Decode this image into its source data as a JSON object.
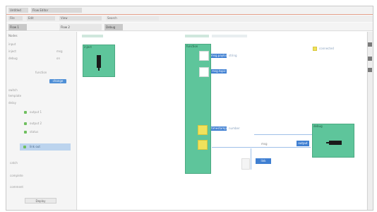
{
  "window": {
    "tabs": [
      "Untitled",
      "Flow Editor"
    ]
  },
  "toolbar": {
    "items": [
      "File",
      "Edit",
      "View",
      "Search"
    ]
  },
  "tabbar": {
    "tabs": [
      "Flow 1",
      "Flow 2",
      "Debug"
    ]
  },
  "sidebar": {
    "header": "Nodes",
    "rows": [
      {
        "label": "input",
        "value": ""
      },
      {
        "label": "inject",
        "value": "msg"
      },
      {
        "label": "debug",
        "value": "on"
      },
      {
        "label": "function",
        "value": ""
      },
      {
        "label": "change",
        "value": ""
      },
      {
        "label": "switch",
        "value": ""
      },
      {
        "label": "template",
        "value": ""
      },
      {
        "label": "delay",
        "value": ""
      }
    ],
    "group_items": [
      {
        "label": "output 1"
      },
      {
        "label": "output 2"
      },
      {
        "label": "status"
      }
    ],
    "selected": "link out",
    "bottom_items": [
      "catch",
      "complete",
      "comment"
    ],
    "action_button": "Deploy"
  },
  "canvas": {
    "node_top_left": {
      "title": "inject"
    },
    "node_center": {
      "title": "function"
    },
    "node_right": {
      "title": "debug"
    },
    "labels": [
      {
        "text": "msg.payload",
        "meta": "string"
      },
      {
        "text": "msg.topic",
        "meta": ""
      },
      {
        "text": "timestamp",
        "meta": "number"
      },
      {
        "text": "output",
        "meta": "msg"
      },
      {
        "text": "link",
        "meta": ""
      }
    ],
    "right_hint": "connected"
  },
  "colors": {
    "node_green": "#5ec59b",
    "accent_blue": "#3f7fd2",
    "highlight_yellow": "#f0e25c",
    "selection": "#bcd4ee"
  }
}
